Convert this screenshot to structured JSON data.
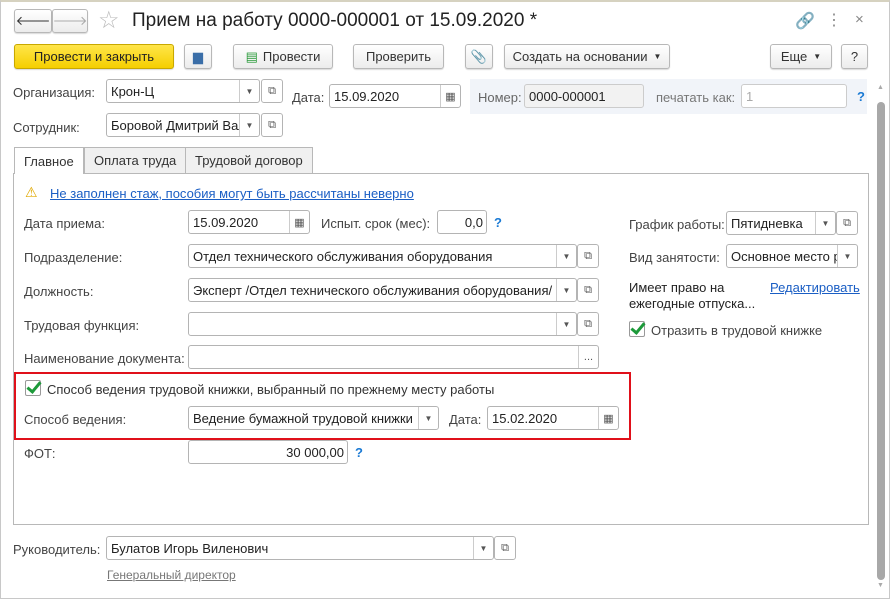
{
  "window": {
    "title": "Прием на работу 0000-000001 от 15.09.2020 *"
  },
  "toolbar": {
    "post_close": "Провести и закрыть",
    "post": "Провести",
    "check": "Проверить",
    "create_based": "Создать на основании",
    "more": "Еще",
    "help": "?"
  },
  "header": {
    "org_label": "Организация:",
    "org_value": "Крон-Ц",
    "date_label": "Дата:",
    "date_value": "15.09.2020",
    "number_label": "Номер:",
    "number_value": "0000-000001",
    "print_as_label": "печатать как:",
    "print_as_value": "1",
    "employee_label": "Сотрудник:",
    "employee_value": "Боровой Дмитрий Вал",
    "help": "?"
  },
  "tabs": [
    {
      "label": "Главное"
    },
    {
      "label": "Оплата труда"
    },
    {
      "label": "Трудовой договор"
    }
  ],
  "main": {
    "warning": "Не заполнен стаж, пособия могут быть рассчитаны неверно",
    "hire_date_label": "Дата приема:",
    "hire_date": "15.09.2020",
    "probation_label": "Испыт. срок (мес):",
    "probation": "0,0",
    "dept_label": "Подразделение:",
    "dept": "Отдел технического обслуживания оборудования",
    "position_label": "Должность:",
    "position": "Эксперт /Отдел технического обслуживания оборудования/",
    "function_label": "Трудовая функция:",
    "function": "",
    "docname_label": "Наименование документа:",
    "docname": "",
    "prev_method_label": "Способ ведения трудовой книжки, выбранный по прежнему месту работы",
    "method_label": "Способ ведения:",
    "method": "Ведение бумажной трудовой книжки",
    "method_date_label": "Дата:",
    "method_date": "15.02.2020",
    "fot_label": "ФОТ:",
    "fot": "30 000,00",
    "schedule_label": "График работы:",
    "schedule": "Пятидневка",
    "employment_label": "Вид занятости:",
    "employment": "Основное место р",
    "vacation_text1": "Имеет право на",
    "vacation_text2": "ежегодные отпуска...",
    "edit_link": "Редактировать",
    "reflect_label": "Отразить в трудовой книжке",
    "help": "?"
  },
  "footer": {
    "manager_label": "Руководитель:",
    "manager": "Булатов Игорь Виленович",
    "manager_position": "Генеральный директор"
  },
  "colors": {
    "accent_yellow": "#f5cf00",
    "highlight_red": "#e0101a",
    "link": "#1a5ec4"
  }
}
